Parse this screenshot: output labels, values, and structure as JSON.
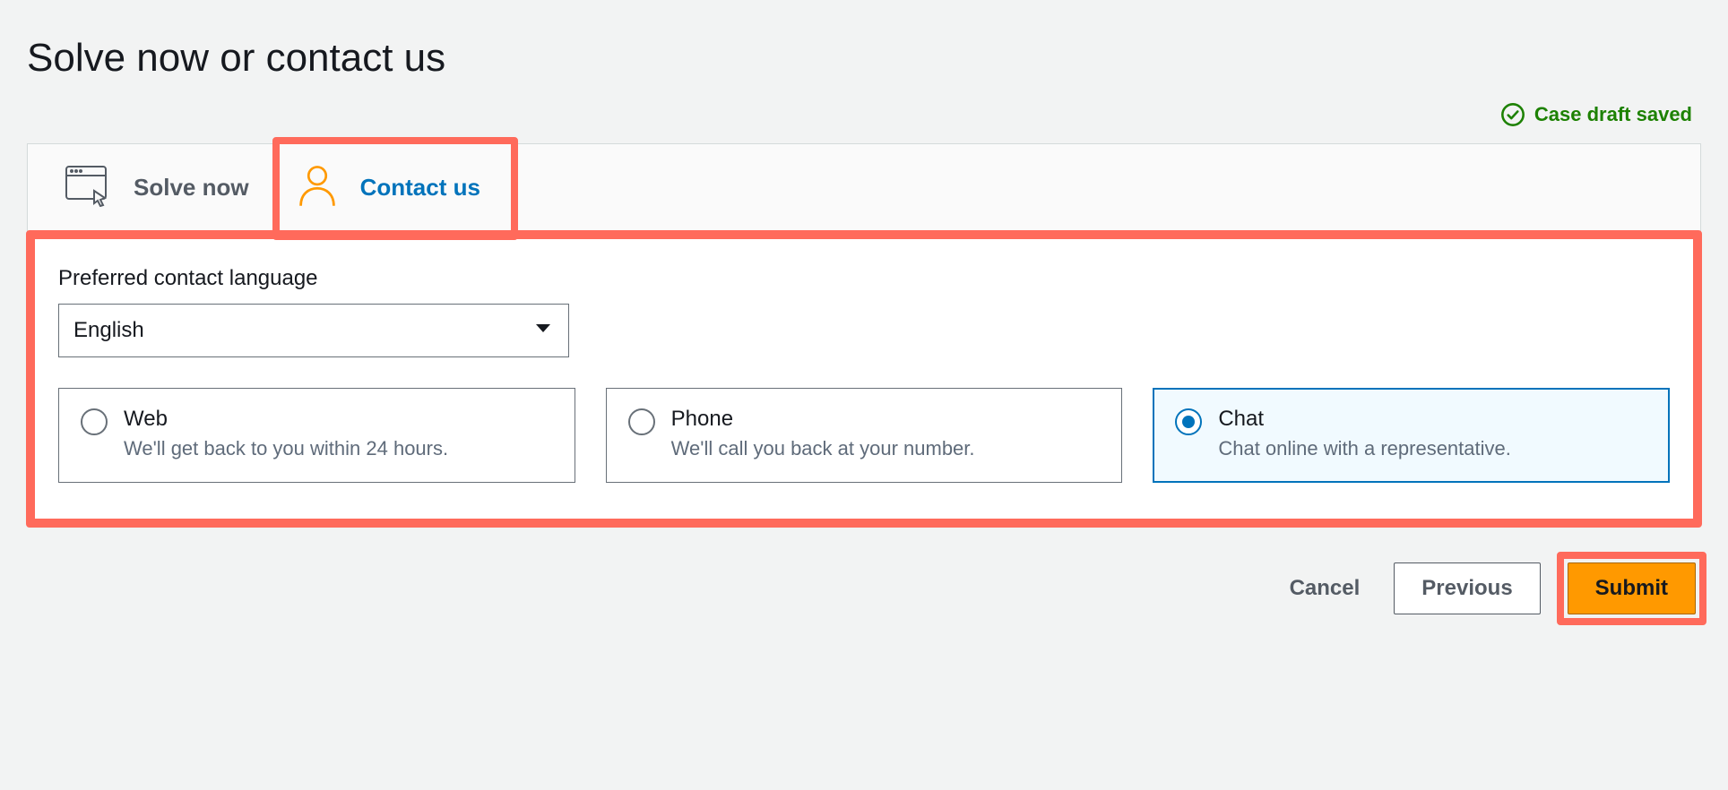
{
  "title": "Solve now or contact us",
  "status": {
    "text": "Case draft saved",
    "color": "#1d8102"
  },
  "tabs": {
    "solve_now": {
      "label": "Solve now"
    },
    "contact_us": {
      "label": "Contact us"
    },
    "active": "contact_us"
  },
  "contact_panel": {
    "language_label": "Preferred contact language",
    "language_value": "English",
    "options": [
      {
        "key": "web",
        "title": "Web",
        "desc": "We'll get back to you within 24 hours."
      },
      {
        "key": "phone",
        "title": "Phone",
        "desc": "We'll call you back at your number."
      },
      {
        "key": "chat",
        "title": "Chat",
        "desc": "Chat online with a representative."
      }
    ],
    "selected_option": "chat"
  },
  "footer": {
    "cancel": "Cancel",
    "previous": "Previous",
    "submit": "Submit"
  },
  "highlight_color": "#ff6a5b"
}
